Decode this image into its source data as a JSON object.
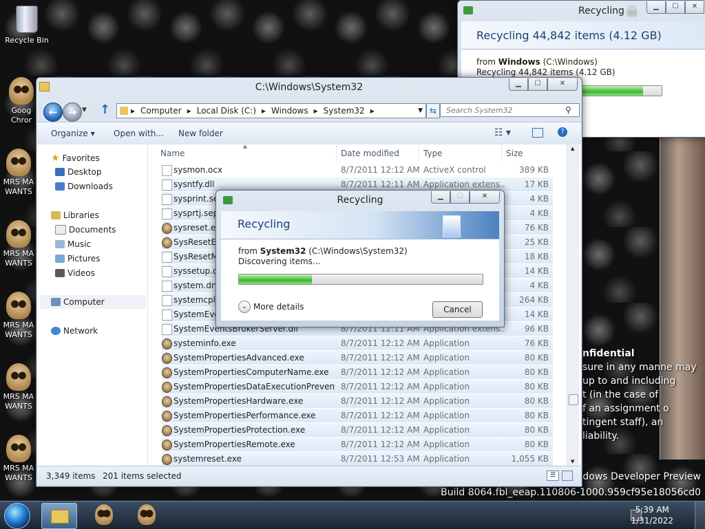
{
  "desktop": {
    "icons": [
      {
        "label": "Recycle Bin"
      },
      {
        "label": "Goog Chror"
      },
      {
        "label": "MRS MA WANTS"
      },
      {
        "label": "MRS MA WANTS"
      },
      {
        "label": "MRS MA WANTS"
      },
      {
        "label": "MRS MA WANTS"
      },
      {
        "label": "MRS MA WANTS"
      }
    ],
    "confidential": [
      "nfidential",
      "sure in any manne may",
      "up to and including",
      "t (in the case of",
      "f an assignment o",
      "tingent staff), an",
      "liability."
    ],
    "watermark_line1": "ndows Developer Preview",
    "watermark_line2": "Build 8064.fbl_eeap.110806-1000.959cf95e18056cd0"
  },
  "big_dialog": {
    "title": "Recycling",
    "heading": "Recycling 44,842 items (4.12 GB)",
    "from_prefix": "from",
    "from_name": "Windows",
    "from_path": "(C:\\Windows)",
    "detail": "Recycling 44,842 items (4.12 GB)",
    "progress": 0.9
  },
  "explorer": {
    "title": "C:\\Windows\\System32",
    "breadcrumb": [
      "Computer",
      "Local Disk (C:)",
      "Windows",
      "System32"
    ],
    "search_placeholder": "Search System32",
    "commands": {
      "organize": "Organize",
      "open_with": "Open with...",
      "new_folder": "New folder"
    },
    "nav": {
      "favorites": "Favorites",
      "desktop": "Desktop",
      "downloads": "Downloads",
      "libraries": "Libraries",
      "documents": "Documents",
      "music": "Music",
      "pictures": "Pictures",
      "videos": "Videos",
      "computer": "Computer",
      "network": "Network"
    },
    "columns": {
      "name": "Name",
      "date": "Date modified",
      "type": "Type",
      "size": "Size"
    },
    "files": [
      {
        "name": "sysmon.ocx",
        "date": "8/7/2011 12:12 AM",
        "type": "ActiveX control",
        "size": "389 KB",
        "icon": "file"
      },
      {
        "name": "sysntfy.dll",
        "date": "8/7/2011 12:11 AM",
        "type": "Application extens...",
        "size": "17 KB",
        "icon": "file"
      },
      {
        "name": "sysprint.sep",
        "date": "",
        "type": "",
        "size": "4 KB",
        "icon": "blank"
      },
      {
        "name": "sysprtj.sep",
        "date": "",
        "type": "",
        "size": "4 KB",
        "icon": "blank"
      },
      {
        "name": "sysreset.exe",
        "date": "",
        "type": "",
        "size": "76 KB",
        "icon": "exe"
      },
      {
        "name": "SysResetErr.",
        "date": "",
        "type": "",
        "size": "25 KB",
        "icon": "exe"
      },
      {
        "name": "SysResetMig",
        "date": "",
        "type": "",
        "size": "18 KB",
        "icon": "file"
      },
      {
        "name": "syssetup.dll",
        "date": "",
        "type": "",
        "size": "14 KB",
        "icon": "file"
      },
      {
        "name": "system.drv",
        "date": "",
        "type": "",
        "size": "4 KB",
        "icon": "file"
      },
      {
        "name": "systemcpl.dl",
        "date": "",
        "type": "",
        "size": "264 KB",
        "icon": "file"
      },
      {
        "name": "SystemEvent",
        "date": "",
        "type": "",
        "size": "14 KB",
        "icon": "file"
      },
      {
        "name": "SystemEventsBrokerServer.dll",
        "date": "8/7/2011 12:11 AM",
        "type": "Application extens...",
        "size": "96 KB",
        "icon": "file"
      },
      {
        "name": "systeminfo.exe",
        "date": "8/7/2011 12:12 AM",
        "type": "Application",
        "size": "76 KB",
        "icon": "exe"
      },
      {
        "name": "SystemPropertiesAdvanced.exe",
        "date": "8/7/2011 12:12 AM",
        "type": "Application",
        "size": "80 KB",
        "icon": "exe"
      },
      {
        "name": "SystemPropertiesComputerName.exe",
        "date": "8/7/2011 12:12 AM",
        "type": "Application",
        "size": "80 KB",
        "icon": "exe"
      },
      {
        "name": "SystemPropertiesDataExecutionPreventio...",
        "date": "8/7/2011 12:12 AM",
        "type": "Application",
        "size": "80 KB",
        "icon": "exe"
      },
      {
        "name": "SystemPropertiesHardware.exe",
        "date": "8/7/2011 12:12 AM",
        "type": "Application",
        "size": "80 KB",
        "icon": "exe"
      },
      {
        "name": "SystemPropertiesPerformance.exe",
        "date": "8/7/2011 12:12 AM",
        "type": "Application",
        "size": "80 KB",
        "icon": "exe"
      },
      {
        "name": "SystemPropertiesProtection.exe",
        "date": "8/7/2011 12:12 AM",
        "type": "Application",
        "size": "80 KB",
        "icon": "exe"
      },
      {
        "name": "SystemPropertiesRemote.exe",
        "date": "8/7/2011 12:12 AM",
        "type": "Application",
        "size": "80 KB",
        "icon": "exe"
      },
      {
        "name": "systemreset.exe",
        "date": "8/7/2011 12:53 AM",
        "type": "Application",
        "size": "1,055 KB",
        "icon": "exe"
      }
    ],
    "status": {
      "count": "3,349 items",
      "selected": "201 items selected"
    }
  },
  "small_dialog": {
    "title": "Recycling",
    "heading": "Recycling",
    "from_prefix": "from",
    "from_name": "System32",
    "from_path": "(C:\\Windows\\System32)",
    "detail": "Discovering items...",
    "progress": 0.3,
    "more_details": "More details",
    "cancel": "Cancel"
  },
  "taskbar": {
    "time": "5:39 AM",
    "date": "1/31/2022"
  }
}
